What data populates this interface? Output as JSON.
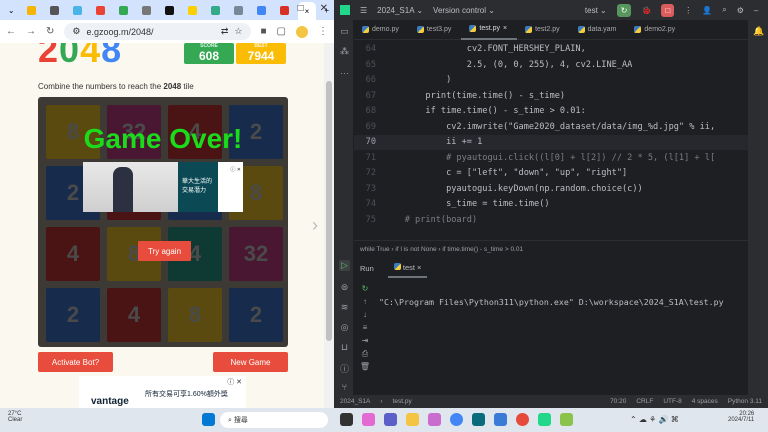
{
  "browser": {
    "url": "e.gzoog.m/2048/",
    "tabs": [
      {
        "color": "#f4b400"
      },
      {
        "color": "#555"
      },
      {
        "color": "#4ab4e6"
      },
      {
        "color": "#ea4335"
      },
      {
        "color": "#34a853"
      },
      {
        "color": "#777"
      },
      {
        "color": "#111"
      },
      {
        "color": "#fbd000"
      },
      {
        "color": "#3a8"
      },
      {
        "color": "#789"
      },
      {
        "color": "#4285f4"
      },
      {
        "color": "#d93025"
      }
    ],
    "active_tab_close": "×",
    "new_tab": "+"
  },
  "game": {
    "score_label": "SCORE",
    "score": "608",
    "best_label": "BEST",
    "best": "7944",
    "description_prefix": "Combine the numbers to reach the ",
    "description_bold": "2048",
    "description_suffix": " tile",
    "game_over": "Game Over!",
    "try_again": "Try again",
    "activate_bot": "Activate Bot?",
    "new_game": "New Game",
    "grid": [
      [
        "8",
        "32",
        "4",
        "2"
      ],
      [
        "2",
        "",
        "",
        "8"
      ],
      [
        "4",
        "8",
        "4",
        "32"
      ],
      [
        "2",
        "4",
        "8",
        "2"
      ]
    ],
    "ad_text": "華大生活的 交易潛力",
    "ad_brand": "vantage",
    "ad2_text": "所有交易可享1.60%額外獎",
    "ad_close": "ⓘ ✕"
  },
  "ide": {
    "project": "2024_S1A",
    "vcs": "Version control",
    "run_config": "test",
    "tabs": [
      "demo.py",
      "test3.py",
      "test.py",
      "test2.py",
      "data.yam",
      "demo2.py"
    ],
    "code": [
      {
        "n": "64",
        "t": "                cv2.FONT_HERSHEY_PLAIN,"
      },
      {
        "n": "65",
        "t": "                2.5, (0, 0, 255), 4, cv2.LINE_AA"
      },
      {
        "n": "66",
        "t": "            )"
      },
      {
        "n": "67",
        "t": "        print(time.time() - s_time)"
      },
      {
        "n": "68",
        "t": "        if time.time() - s_time > 0.01:"
      },
      {
        "n": "69",
        "t": "            cv2.imwrite(\"Game2020_dataset/data/img_%d.jpg\" % ii,"
      },
      {
        "n": "70",
        "t": "            ii += 1"
      },
      {
        "n": "71",
        "t": "            # pyautogui.click((l[0] + l[2]) // 2 * 5, (l[1] + l["
      },
      {
        "n": "72",
        "t": "            c = [\"left\", \"down\", \"up\", \"right\"]"
      },
      {
        "n": "73",
        "t": "            pyautogui.keyDown(np.random.choice(c))"
      },
      {
        "n": "74",
        "t": "            s_time = time.time()"
      },
      {
        "n": "75",
        "t": "    # print(board)"
      }
    ],
    "breadcrumb": "while True  ›  if l is not None  ›  if time.time() - s_time > 0.01",
    "run_label": "Run",
    "run_tab": "test",
    "console": "\"C:\\Program Files\\Python311\\python.exe\" D:\\workspace\\2024_S1A\\test.py",
    "status": {
      "project": "2024_S1A",
      "file": "test.py",
      "pos": "70:20",
      "eol": "CRLF",
      "enc": "UTF-8",
      "indent": "4 spaces",
      "interp": "Python 3.11"
    }
  },
  "taskbar": {
    "weather_temp": "27°C",
    "weather_desc": "Clear",
    "search": "搜尋",
    "time": "20:26",
    "date": "2024/7/11"
  }
}
